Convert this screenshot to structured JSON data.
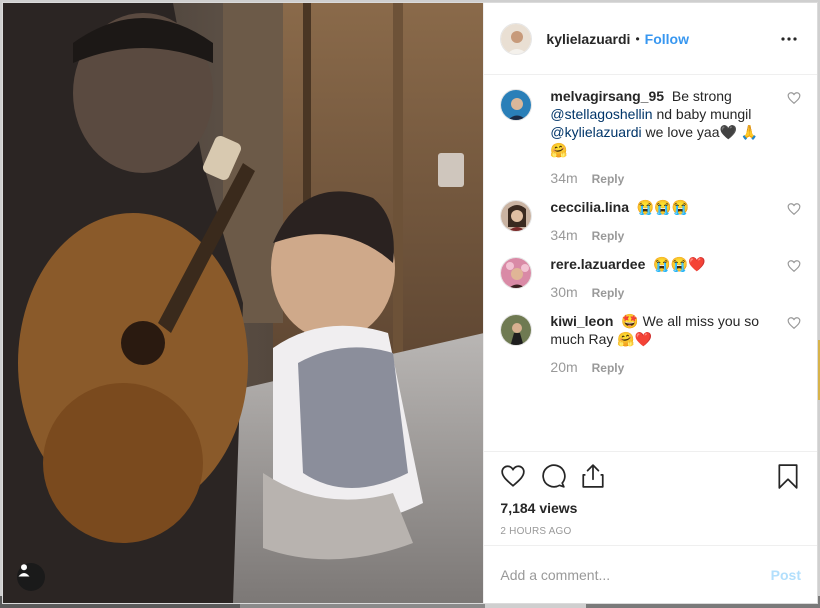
{
  "post": {
    "username": "kylielazuardi",
    "separator": "•",
    "follow_label": "Follow",
    "more_icon": "more-horizontal-icon"
  },
  "comments": [
    {
      "username": "melvagirsang_95",
      "text_parts": [
        "Be strong",
        "@stellagoshellin",
        "nd baby mungil",
        "@kylielazuardi",
        "we love yaa🖤 🙏",
        "🤗"
      ],
      "time": "34m",
      "reply_label": "Reply"
    },
    {
      "username": "ceccilia.lina",
      "text": "😭😭😭",
      "time": "34m",
      "reply_label": "Reply"
    },
    {
      "username": "rere.lazuardee",
      "text": "😭😭❤️",
      "time": "30m",
      "reply_label": "Reply"
    },
    {
      "username": "kiwi_leon",
      "text": "🤩 We all miss you so much Ray 🤗❤️",
      "time": "20m",
      "reply_label": "Reply"
    }
  ],
  "stats": {
    "views": "7,184 views",
    "age": "2 HOURS AGO"
  },
  "add_comment": {
    "placeholder": "Add a comment...",
    "post_label": "Post"
  },
  "colors": {
    "link": "#3897f0",
    "mention": "#003569",
    "muted": "#999999",
    "post_disabled": "#b2dffc"
  }
}
